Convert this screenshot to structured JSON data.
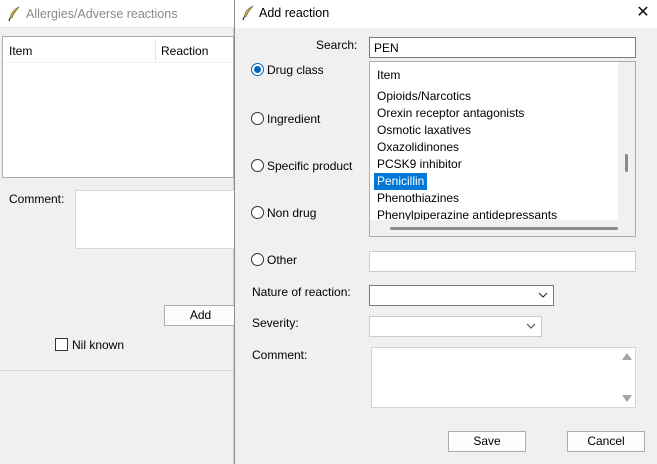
{
  "background_window": {
    "title": "Allergies/Adverse reactions",
    "columns": [
      "Item",
      "Reaction"
    ],
    "comment_label": "Comment:",
    "add_label": "Add",
    "nil_known_label": "Nil known"
  },
  "dialog": {
    "title": "Add reaction",
    "close_symbol": "✕",
    "search_label": "Search:",
    "search_value": "PEN",
    "radios": [
      {
        "label": "Drug class",
        "selected": true
      },
      {
        "label": "Ingredient",
        "selected": false
      },
      {
        "label": "Specific product",
        "selected": false
      },
      {
        "label": "Non drug",
        "selected": false
      },
      {
        "label": "Other",
        "selected": false
      }
    ],
    "list": {
      "header": "Item",
      "items": [
        "Opioids/Narcotics",
        "Orexin receptor antagonists",
        "Osmotic laxatives",
        "Oxazolidinones",
        "PCSK9 inhibitor",
        "Penicillin",
        "Phenothiazines",
        "Phenylpiperazine antidepressants"
      ],
      "selected": "Penicillin"
    },
    "nature_label": "Nature of reaction:",
    "nature_value": "",
    "severity_label": "Severity:",
    "severity_value": "",
    "comment_label": "Comment:",
    "save_label": "Save",
    "cancel_label": "Cancel"
  },
  "colors": {
    "accent": "#0078d7",
    "radio_accent": "#0067c0",
    "window_bg": "#f0f0f0"
  },
  "icons": {
    "app_icon": "quill-feather-icon",
    "close": "close-icon",
    "dropdown": "chevron-down-icon"
  }
}
